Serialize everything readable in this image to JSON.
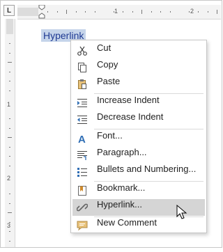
{
  "ruler": {
    "tab_selector": "L",
    "horizontal_numbers": [
      "1",
      "2"
    ],
    "vertical_numbers": [
      "1",
      "2",
      "3"
    ]
  },
  "document": {
    "selected_text": "Hyperlink"
  },
  "context_menu": {
    "items": [
      {
        "label": "Cut",
        "icon": "scissors-icon"
      },
      {
        "label": "Copy",
        "icon": "copy-icon"
      },
      {
        "label": "Paste",
        "icon": "paste-icon"
      },
      {
        "label": "Increase Indent",
        "icon": "increase-indent-icon"
      },
      {
        "label": "Decrease Indent",
        "icon": "decrease-indent-icon"
      },
      {
        "label": "Font...",
        "icon": "font-icon"
      },
      {
        "label": "Paragraph...",
        "icon": "paragraph-icon"
      },
      {
        "label": "Bullets and Numbering...",
        "icon": "bullets-icon"
      },
      {
        "label": "Bookmark...",
        "icon": "bookmark-icon"
      },
      {
        "label": "Hyperlink...",
        "icon": "hyperlink-icon",
        "highlighted": true
      },
      {
        "label": "New Comment",
        "icon": "comment-icon"
      }
    ]
  },
  "colors": {
    "selection": "#c5d4ea",
    "menu_hover": "#d5d5d5",
    "icon_blue": "#2e6db4",
    "comment_yellow": "#e8c27a"
  }
}
